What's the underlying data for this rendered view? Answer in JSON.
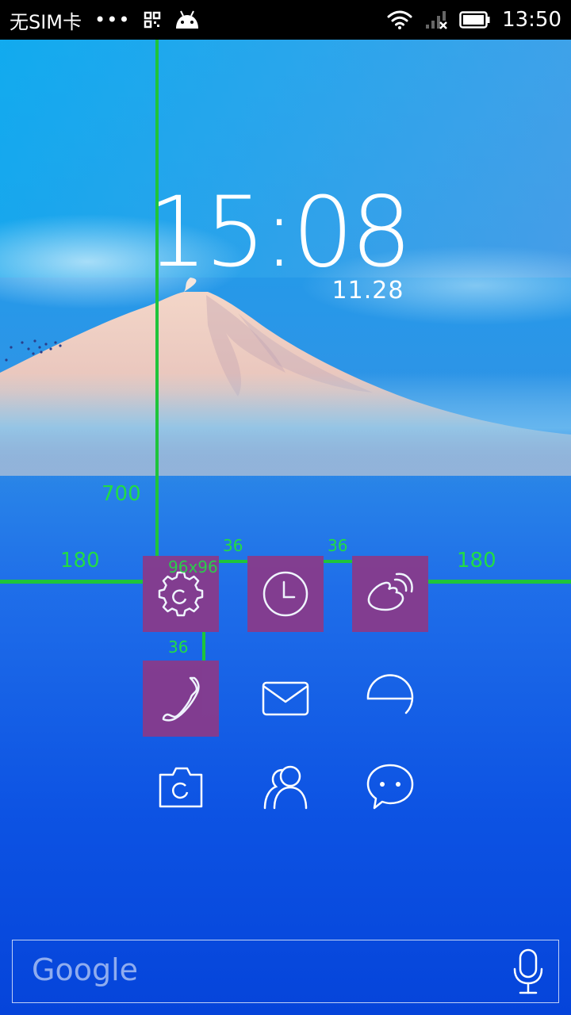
{
  "status_bar": {
    "carrier": "无SIM卡",
    "dots": "•••",
    "time": "13:50",
    "icons": [
      "qr-code-icon",
      "android-icon",
      "wifi-icon",
      "signal-icon",
      "battery-icon"
    ]
  },
  "clock": {
    "time": "15:08",
    "date": "11.28"
  },
  "guides": {
    "top_spacing": "700",
    "left_margin": "180",
    "right_margin": "180",
    "icon_size": "96x96",
    "gap_1": "36",
    "gap_2": "36",
    "gap_vertical": "36",
    "color": "#1ec43b"
  },
  "apps": [
    {
      "name": "settings",
      "icon": "settings-gear-icon",
      "highlighted": true
    },
    {
      "name": "clock",
      "icon": "clock-icon",
      "highlighted": true
    },
    {
      "name": "weibo",
      "icon": "weibo-icon",
      "highlighted": true
    },
    {
      "name": "phone",
      "icon": "phone-icon",
      "highlighted": true
    },
    {
      "name": "mail",
      "icon": "mail-icon",
      "highlighted": false
    },
    {
      "name": "browser",
      "icon": "browser-e-icon",
      "highlighted": false
    },
    {
      "name": "camera",
      "icon": "camera-icon",
      "highlighted": false
    },
    {
      "name": "contacts",
      "icon": "contacts-icon",
      "highlighted": false
    },
    {
      "name": "messages",
      "icon": "chat-bubble-icon",
      "highlighted": false
    }
  ],
  "tile_color": "#8a3a8a",
  "search": {
    "placeholder": "Google",
    "icon": "microphone-icon"
  }
}
